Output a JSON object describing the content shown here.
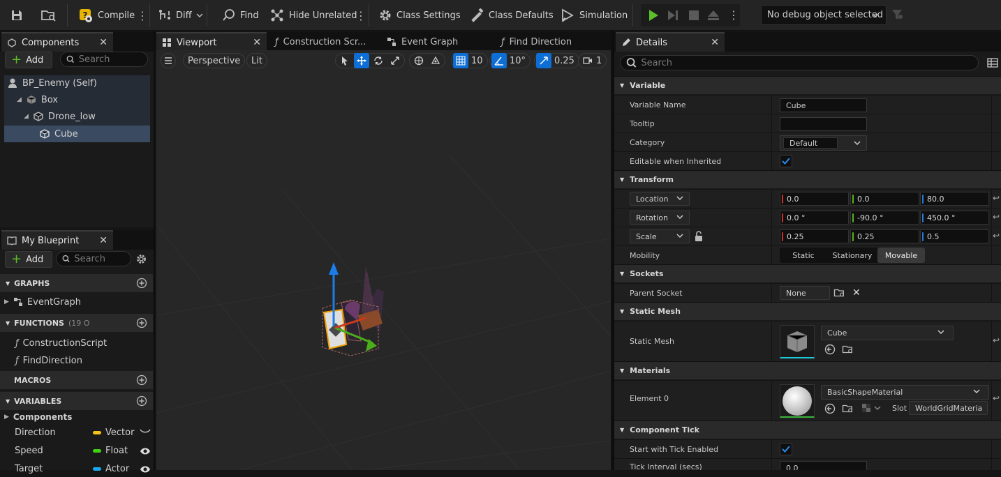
{
  "toolbar": {
    "compile": "Compile",
    "diff": "Diff",
    "find": "Find",
    "hide_unrelated": "Hide Unrelated",
    "class_settings": "Class Settings",
    "class_defaults": "Class Defaults",
    "simulation": "Simulation",
    "debug_object": "No debug object selected"
  },
  "components": {
    "tab": "Components",
    "add": "Add",
    "search_placeholder": "Search",
    "tree": [
      "BP_Enemy (Self)",
      "Box",
      "Drone_low",
      "Cube"
    ]
  },
  "my_blueprint": {
    "tab": "My Blueprint",
    "add": "Add",
    "search_placeholder": "Search",
    "graphs": "GRAPHS",
    "event_graph": "EventGraph",
    "functions": "FUNCTIONS",
    "functions_count": "(19 O",
    "construction_script": "ConstructionScript",
    "find_direction": "FindDirection",
    "macros": "MACROS",
    "variables": "VARIABLES",
    "components_cat": "Components",
    "vars": [
      {
        "name": "Direction",
        "type": "Vector",
        "color": "#f2c21b"
      },
      {
        "name": "Speed",
        "type": "Float",
        "color": "#3fd30f"
      },
      {
        "name": "Target",
        "type": "Actor",
        "color": "#1ba7f2"
      }
    ]
  },
  "tabs": {
    "viewport": "Viewport",
    "construction": "Construction Scr...",
    "event_graph": "Event Graph",
    "find_direction": "Find Direction"
  },
  "viewport": {
    "perspective": "Perspective",
    "lit": "Lit",
    "grid_snap": "10",
    "rot_snap": "10°",
    "scale_snap": "0.25",
    "cam_speed": "1"
  },
  "details": {
    "tab": "Details",
    "search_placeholder": "Search",
    "variable": {
      "title": "Variable",
      "name_label": "Variable Name",
      "name_value": "Cube",
      "tooltip_label": "Tooltip",
      "category_label": "Category",
      "category_value": "Default",
      "editable_label": "Editable when Inherited"
    },
    "transform": {
      "title": "Transform",
      "location": "Location",
      "rotation": "Rotation",
      "scale": "Scale",
      "loc": [
        "0.0",
        "0.0",
        "80.0"
      ],
      "rot": [
        "0.0 °",
        "-90.0 °",
        "450.0 °"
      ],
      "scl": [
        "0.25",
        "0.25",
        "0.5"
      ],
      "mobility": "Mobility",
      "mob_options": [
        "Static",
        "Stationary",
        "Movable"
      ]
    },
    "sockets": {
      "title": "Sockets",
      "parent": "Parent Socket",
      "value": "None"
    },
    "static_mesh": {
      "title": "Static Mesh",
      "label": "Static Mesh",
      "value": "Cube"
    },
    "materials": {
      "title": "Materials",
      "label": "Element 0",
      "value": "BasicShapeMaterial",
      "slot": "Slot",
      "slot_value": "WorldGridMateria"
    },
    "component_tick": {
      "title": "Component Tick",
      "start": "Start with Tick Enabled",
      "interval": "Tick Interval (secs)",
      "interval_value": "0.0"
    }
  }
}
